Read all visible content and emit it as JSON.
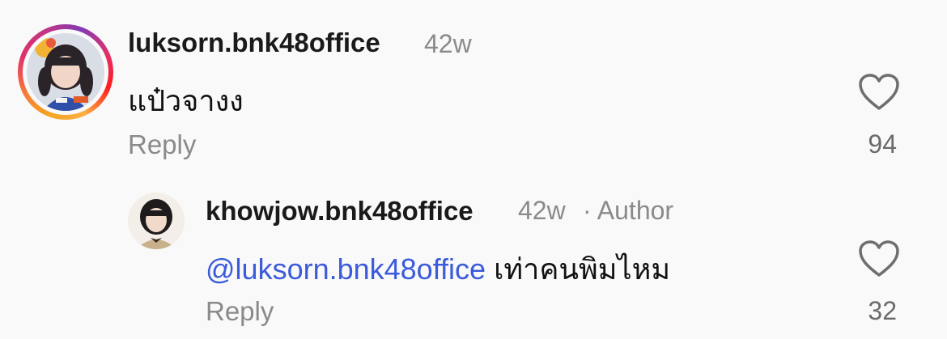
{
  "comments": [
    {
      "username": "luksorn.bnk48office",
      "age": "42w",
      "text": "แป๋วจางง",
      "reply_label": "Reply",
      "like_count": "94"
    }
  ],
  "replies": [
    {
      "username": "khowjow.bnk48office",
      "age": "42w",
      "author_badge": "· Author",
      "mention": "@luksorn.bnk48office",
      "text": "เท่าคนพิมไหม",
      "reply_label": "Reply",
      "like_count": "32"
    }
  ],
  "icons": {
    "like": "heart-outline-icon"
  },
  "colors": {
    "mention": "#3b5bdb",
    "muted": "#8a8a8a",
    "background": "#f9f9f9"
  }
}
